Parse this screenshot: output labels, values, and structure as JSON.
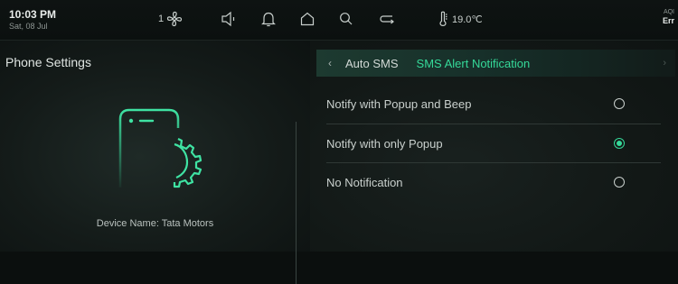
{
  "status_bar": {
    "time": "10:03 PM",
    "date": "Sat, 08 Jul",
    "fan_level": "1",
    "temperature": "19.0℃",
    "aqi_label": "AQI",
    "aqi_value": "Err",
    "icons": [
      "fan-icon",
      "speaker-icon",
      "bell-icon",
      "home-icon",
      "search-icon",
      "recirculation-icon",
      "thermometer-icon"
    ]
  },
  "left": {
    "title": "Phone Settings",
    "device_name": "Device Name: Tata Motors"
  },
  "breadcrumb": {
    "back_glyph": "‹",
    "parent": "Auto SMS",
    "current": "SMS Alert Notification",
    "next_glyph": "›"
  },
  "options": [
    {
      "label": "Notify with Popup and Beep",
      "selected": false
    },
    {
      "label": "Notify with only Popup",
      "selected": true
    },
    {
      "label": "No Notification",
      "selected": false
    }
  ],
  "colors": {
    "accent": "#35d999",
    "background": "#0b0f0e"
  }
}
